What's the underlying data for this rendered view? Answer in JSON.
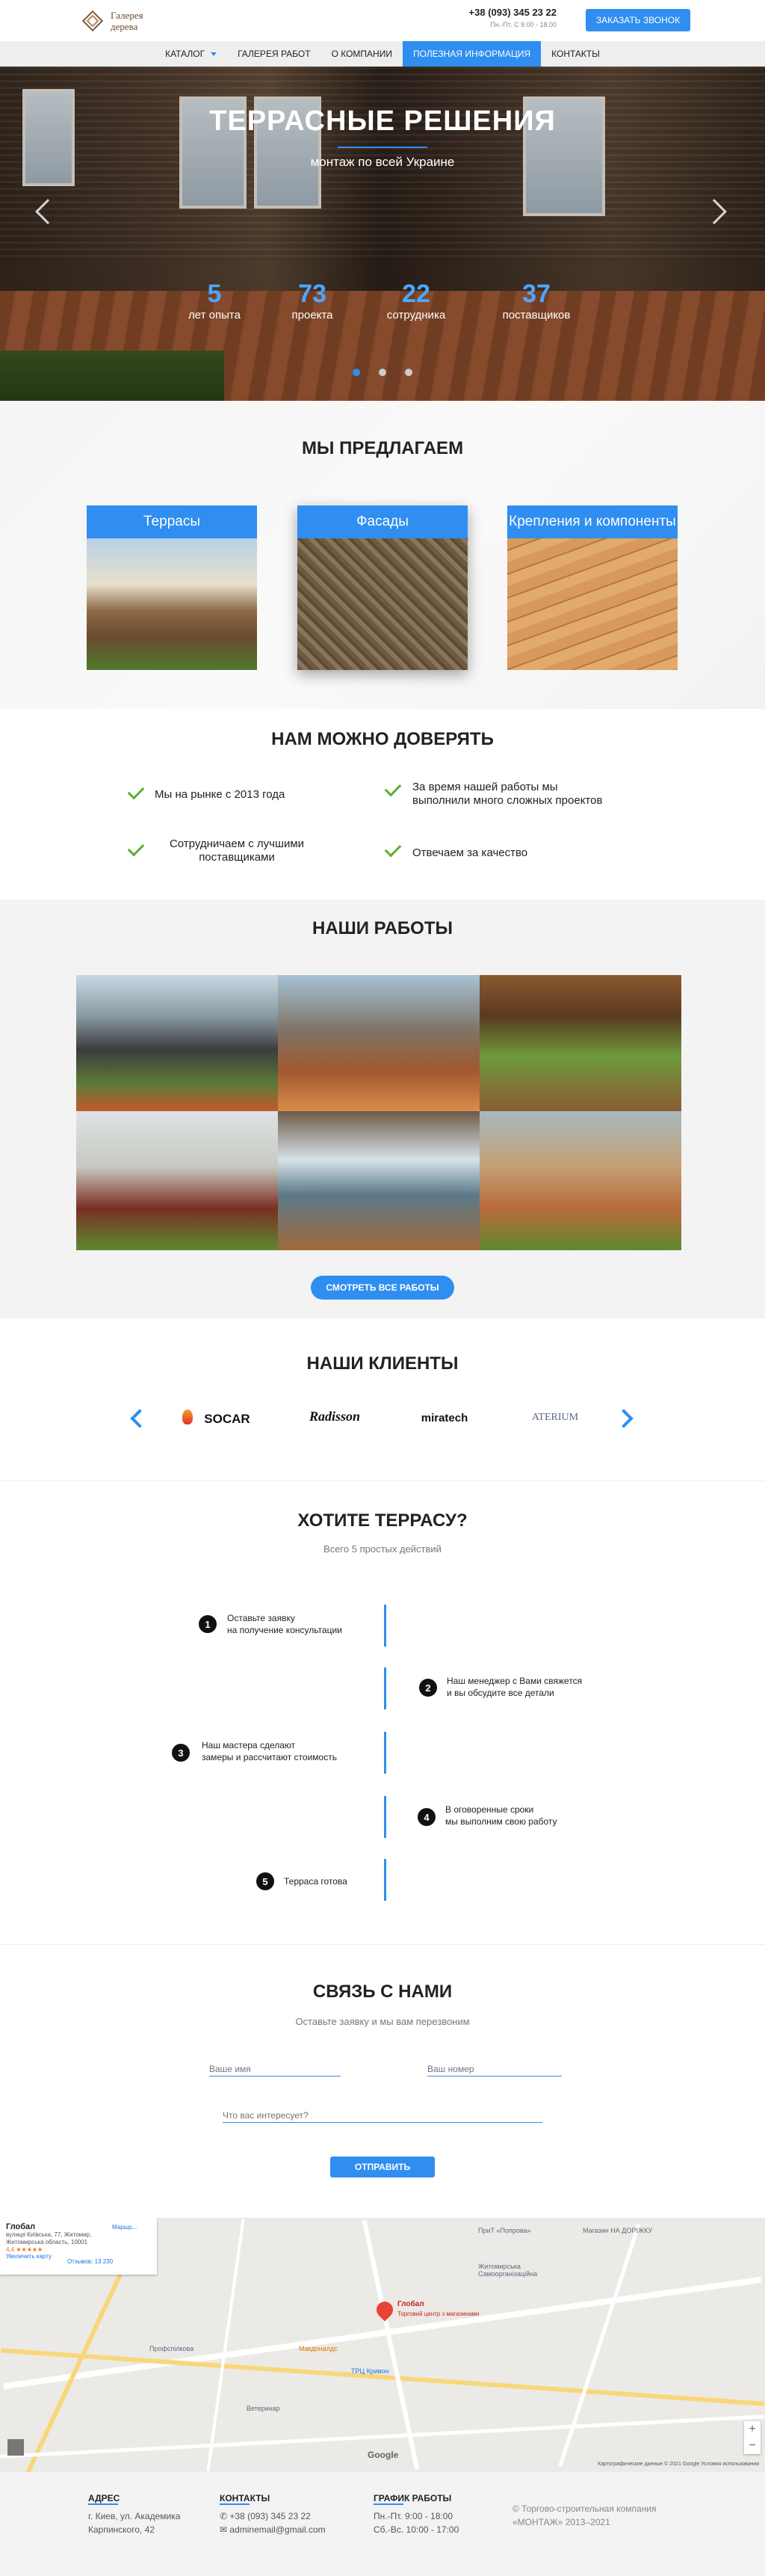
{
  "header": {
    "logo_line1": "Галерея",
    "logo_line2": "дерева",
    "phone": "+38 (093) 345 23 22",
    "hours": "Пн.-Пт. С 9.00 - 18.00",
    "call_button": "ЗАКАЗАТЬ ЗВОНОК"
  },
  "nav": {
    "items": [
      {
        "label": "КАТАЛОГ"
      },
      {
        "label": "ГАЛЕРЕЯ РАБОТ"
      },
      {
        "label": "О КОМПАНИИ"
      },
      {
        "label": "ПОЛЕЗНАЯ ИНФОРМАЦИЯ"
      },
      {
        "label": "КОНТАКТЫ"
      }
    ]
  },
  "hero": {
    "title": "ТЕРРАСНЫЕ РЕШЕНИЯ",
    "subtitle": "монтаж по всей Украине",
    "stats": [
      {
        "num": "5",
        "label": "лет опыта"
      },
      {
        "num": "73",
        "label": "проекта"
      },
      {
        "num": "22",
        "label": "сотрудника"
      },
      {
        "num": "37",
        "label": "поставщиков"
      }
    ]
  },
  "offer": {
    "title": "МЫ ПРЕДЛАГАЕМ",
    "cards": [
      {
        "label": "Террасы"
      },
      {
        "label": "Фасады"
      },
      {
        "label": "Крепления и компоненты"
      }
    ]
  },
  "trust": {
    "title": "НАМ МОЖНО ДОВЕРЯТЬ",
    "items": [
      "Мы на рынке с 2013 года",
      "За время нашей работы мы выполнили много сложных проектов",
      "Сотрудничаем с лучшими поставщиками",
      "Отвечаем за качество"
    ]
  },
  "works": {
    "title": "НАШИ РАБОТЫ",
    "button": "СМОТРЕТЬ ВСЕ РАБОТЫ"
  },
  "clients": {
    "title": "НАШИ КЛИЕНТЫ",
    "logos": [
      "SOCAR",
      "Radisson",
      "miratech",
      "ATERIUM"
    ]
  },
  "steps": {
    "title": "ХОТИТЕ ТЕРРАСУ?",
    "subtitle": "Всего 5 простых действий",
    "items": [
      {
        "num": "1",
        "text1": "Оставьте заявку",
        "text2": "на получение консультации"
      },
      {
        "num": "2",
        "text1": "Наш менеджер с Вами свяжется",
        "text2": "и вы обсудите все детали"
      },
      {
        "num": "3",
        "text1": "Наш мастера сделают",
        "text2": "замеры и рассчитают стоимость"
      },
      {
        "num": "4",
        "text1": "В оговоренные сроки",
        "text2": "мы выполним свою работу"
      },
      {
        "num": "5",
        "text1": "Терраса готова",
        "text2": ""
      }
    ]
  },
  "contact": {
    "title": "СВЯЗЬ С НАМИ",
    "subtitle": "Оставьте заявку и мы вам перезвоним",
    "name_placeholder": "Ваше имя",
    "phone_placeholder": "Ваш номер",
    "interest_placeholder": "Что вас интересует?",
    "submit": "ОТПРАВИТЬ"
  },
  "map": {
    "card_title": "Глобал",
    "card_addr": "вулиця Київська, 77, Житомир, Житомирська область, 10001",
    "card_rating": "4,4 ★★★★★",
    "card_reviews": "Отзывов: 13 230",
    "card_link": "Увеличить карту",
    "route_label": "Маршр...",
    "pin_label": "Глобал",
    "pin_sub": "Торговий центр з магазинами",
    "place_labels": [
      "ПриТ «Попрова»",
      "Магазин НА ДОРІЖКУ",
      "Макдоналдс",
      "ТРЦ Кривон",
      "Профспілкова",
      "Ветеринар",
      "Житомирська Самоорганізаційна"
    ],
    "google": "Google",
    "footer_text": "Картографические данные © 2021 Google  Условия использования"
  },
  "footer": {
    "addr_head": "АДРЕС",
    "addr_text1": "г. Киев, ул. Академика",
    "addr_text2": "Карпинского, 42",
    "contacts_head": "КОНТАКТЫ",
    "phone": "+38 (093) 345 23 22",
    "email": "adminemail@gmail.com",
    "schedule_head": "ГРАФИК РАБОТЫ",
    "schedule1": "Пн.-Пт. 9:00 - 18:00",
    "schedule2": "Сб.-Вс. 10:00 - 17:00",
    "copyright1": "© Торгово-строительная компания",
    "copyright2": "«МОНТАЖ» 2013–2021"
  }
}
